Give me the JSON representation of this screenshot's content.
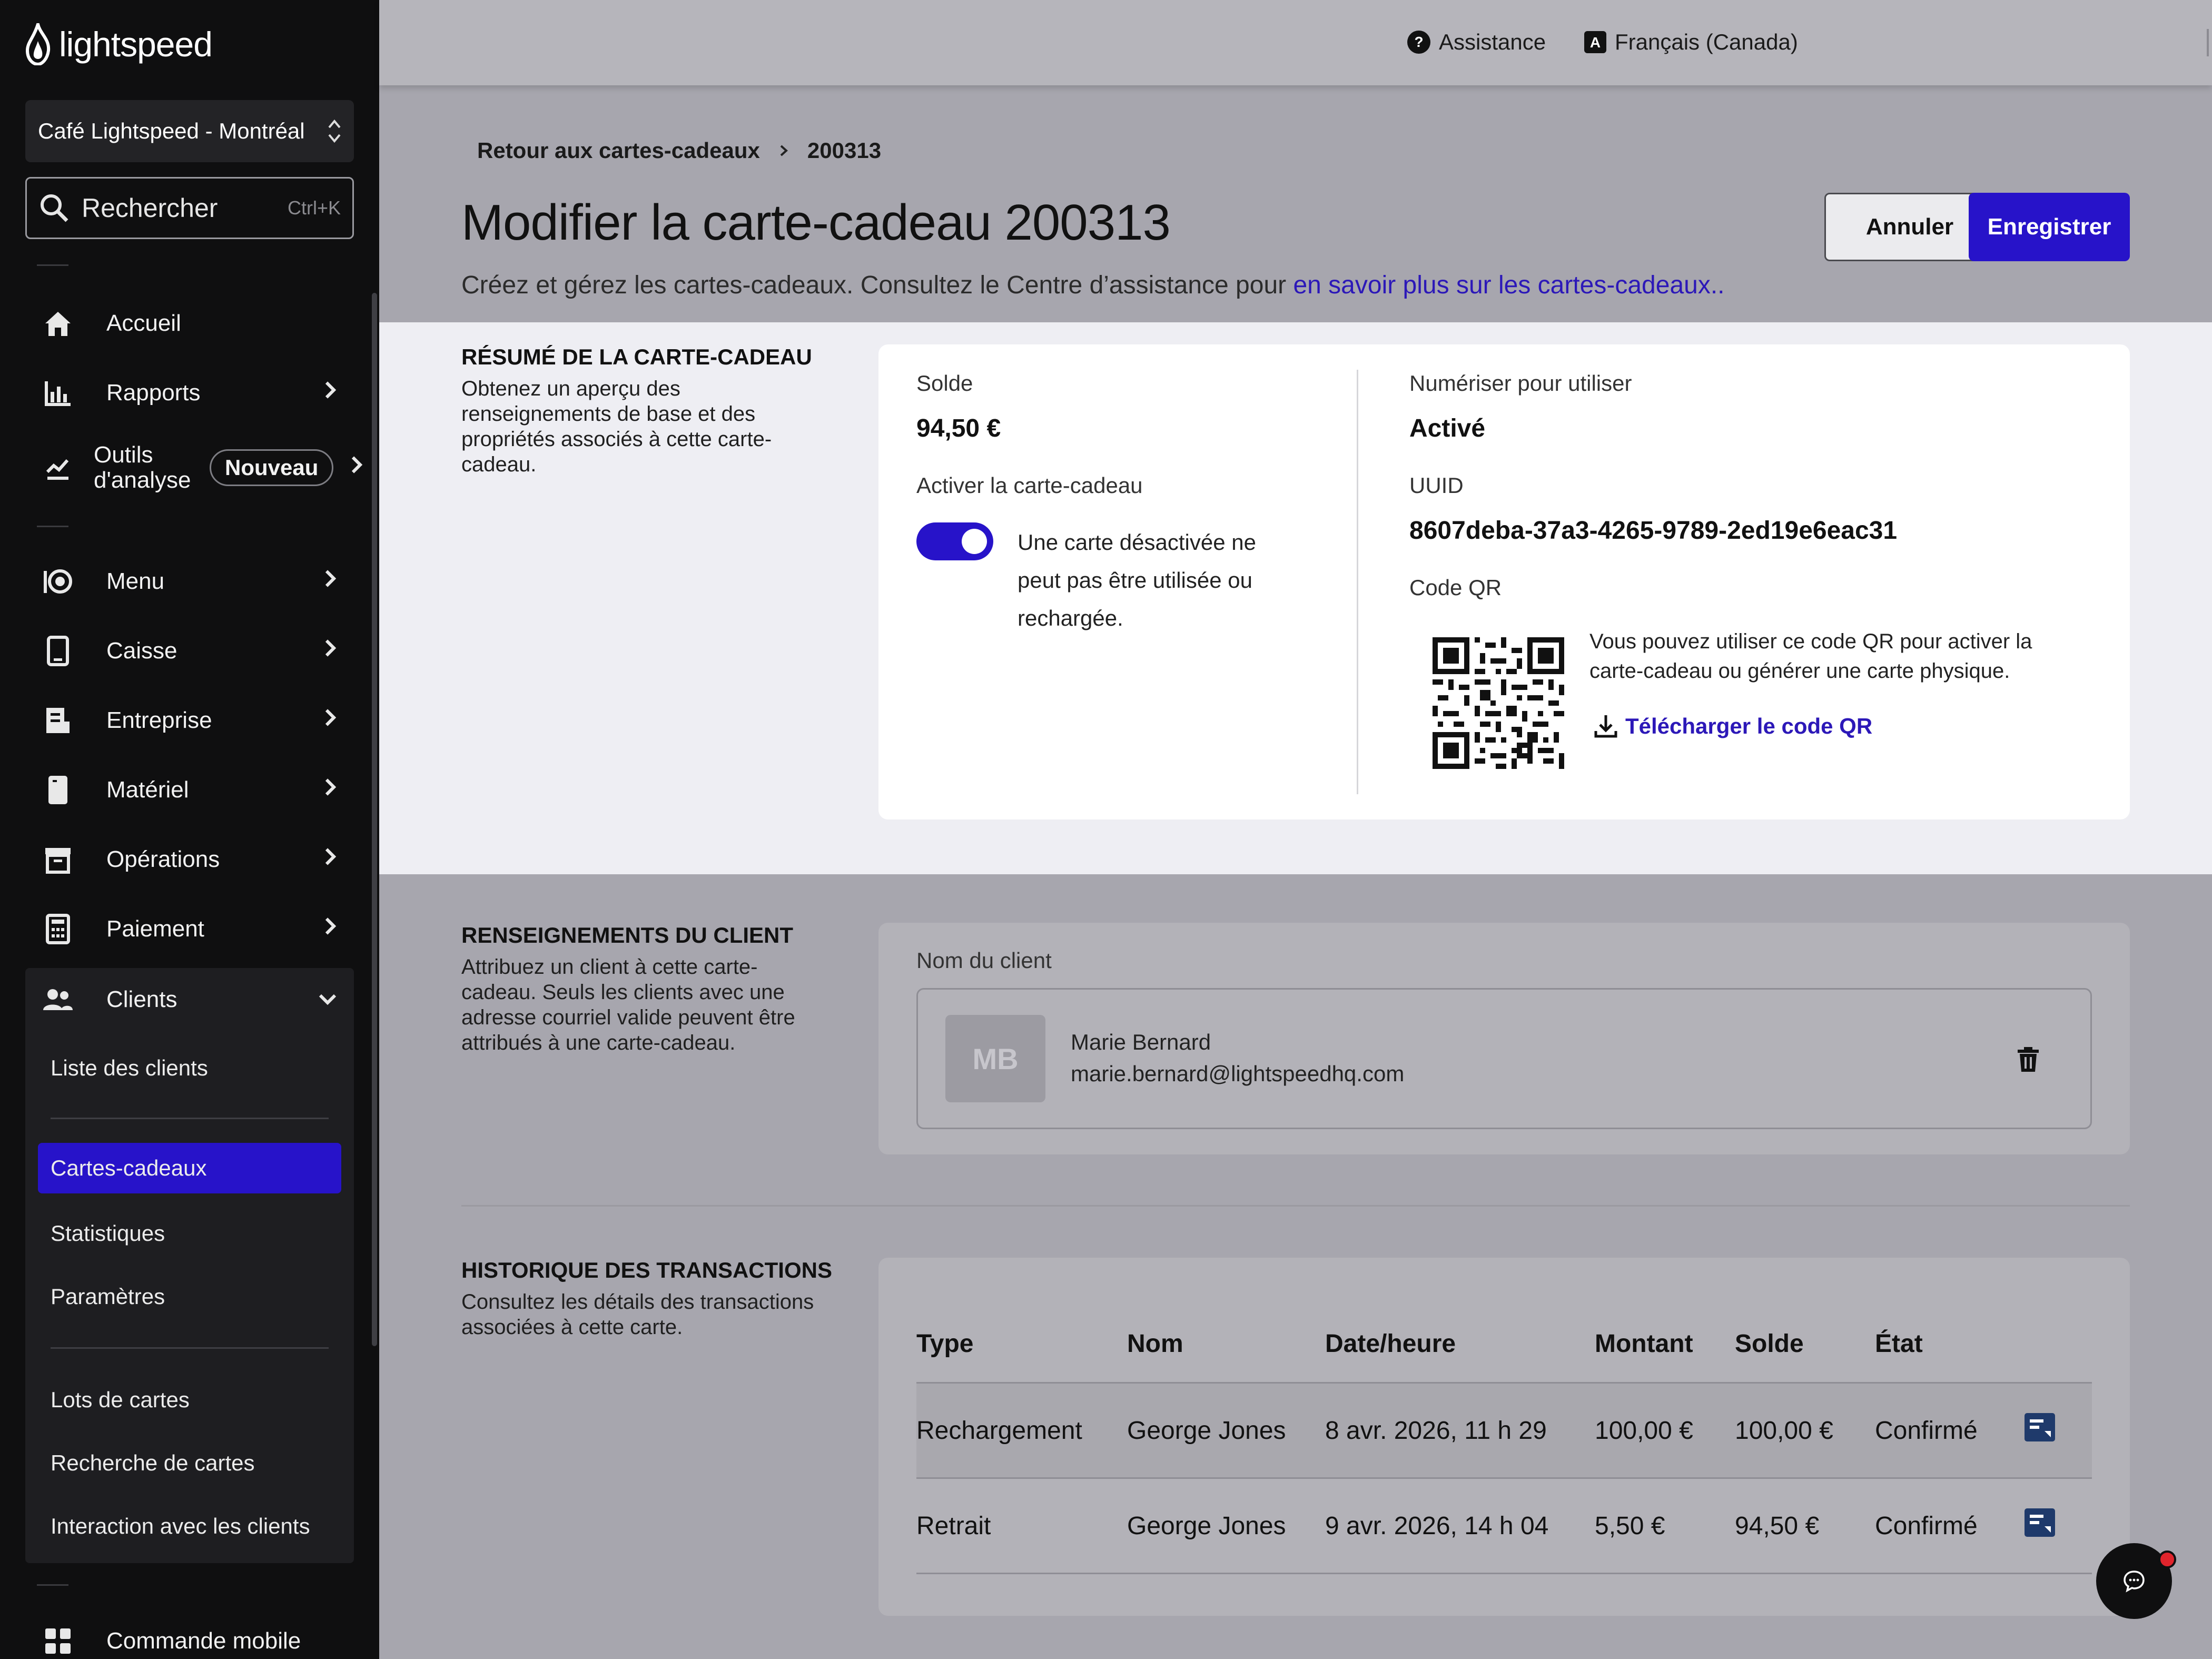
{
  "app": {
    "brand": "lightspeed",
    "accent_color": "#2713c9",
    "link_color": "#2c18b8"
  },
  "sidebar": {
    "store": "Café Lightspeed - Montréal",
    "search": {
      "label": "Rechercher",
      "shortcut": "Ctrl+K"
    },
    "items": [
      {
        "label": "Accueil",
        "icon": "home-icon"
      },
      {
        "label": "Rapports",
        "icon": "bar-chart-icon"
      },
      {
        "label": "Outils d'analyse",
        "icon": "analytics-icon",
        "badge": "Nouveau"
      },
      {
        "label": "Menu",
        "icon": "menu-icon"
      },
      {
        "label": "Caisse",
        "icon": "tablet-icon"
      },
      {
        "label": "Entreprise",
        "icon": "business-icon"
      },
      {
        "label": "Matériel",
        "icon": "hardware-icon"
      },
      {
        "label": "Opérations",
        "icon": "archive-icon"
      },
      {
        "label": "Paiement",
        "icon": "calculator-icon"
      },
      {
        "label": "Clients",
        "icon": "users-icon"
      },
      {
        "label": "Commande mobile",
        "icon": "grid-icon"
      }
    ],
    "clients_sub": [
      "Liste des clients",
      "Cartes-cadeaux",
      "Statistiques",
      "Paramètres",
      "Lots de cartes",
      "Recherche de cartes",
      "Interaction avec les clients"
    ],
    "active_sub": "Cartes-cadeaux"
  },
  "topbar": {
    "help": "Assistance",
    "language": "Français (Canada)"
  },
  "breadcrumb": {
    "back": "Retour aux cartes-cadeaux",
    "current": "200313"
  },
  "page": {
    "title": "Modifier la carte-cadeau 200313",
    "subtitle": "Créez et gérez les cartes-cadeaux. Consultez le Centre d’assistance pour ",
    "subtitle_link": "en savoir plus sur les cartes-cadeaux..",
    "cancel": "Annuler",
    "save": "Enregistrer"
  },
  "summary": {
    "heading": "RÉSUMÉ DE LA CARTE-CADEAU",
    "description": "Obtenez un aperçu des renseignements de base et des propriétés associés à cette carte-cadeau.",
    "balance_label": "Solde",
    "balance": "94,50 €",
    "activate_label": "Activer la carte-cadeau",
    "activate_on": true,
    "activate_help": "Une carte désactivée ne peut pas être utilisée ou rechargée.",
    "scan_label": "Numériser pour utiliser",
    "scan_value": "Activé",
    "uuid_label": "UUID",
    "uuid": "8607deba-37a3-4265-9789-2ed19e6eac31",
    "qr_label": "Code QR",
    "qr_desc": "Vous pouvez utiliser ce code QR pour activer la carte-cadeau ou générer une carte physique.",
    "qr_download": "Télécharger le code QR"
  },
  "client": {
    "heading": "RENSEIGNEMENTS DU CLIENT",
    "description": "Attribuez un client à cette carte-cadeau. Seuls les clients avec une adresse courriel valide peuvent être attribués à une carte-cadeau.",
    "name_label": "Nom du client",
    "initials": "MB",
    "name": "Marie Bernard",
    "email": "marie.bernard@lightspeedhq.com"
  },
  "transactions": {
    "heading": "HISTORIQUE DES TRANSACTIONS",
    "description": "Consultez les détails des transactions associées à cette carte.",
    "columns": [
      "Type",
      "Nom",
      "Date/heure",
      "Montant",
      "Solde",
      "État"
    ],
    "rows": [
      [
        "Rechargement",
        "George Jones",
        "8 avr. 2026, 11 h 29",
        "100,00 €",
        "100,00 €",
        "Confirmé"
      ],
      [
        "Retrait",
        "George Jones",
        "9 avr. 2026, 14 h 04",
        "5,50 €",
        "94,50 €",
        "Confirmé"
      ]
    ]
  }
}
